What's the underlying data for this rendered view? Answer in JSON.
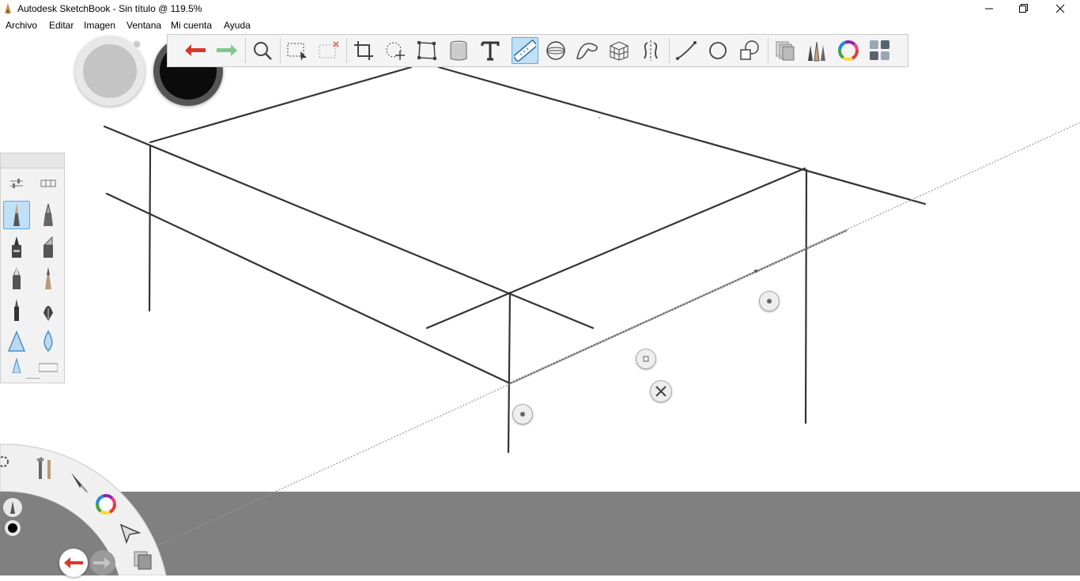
{
  "window": {
    "title": "Autodesk SketchBook - Sin título @ 119.5%",
    "controls": [
      "minimize-icon",
      "maximize-icon",
      "close-icon"
    ]
  },
  "menubar": {
    "items": [
      "Archivo",
      "Editar",
      "Imagen",
      "Ventana",
      "Mi cuenta",
      "Ayuda"
    ]
  },
  "toolbar": {
    "tools": [
      "undo-icon",
      "redo-icon",
      "zoom-icon",
      "rectangle-select-icon",
      "clear-selection-icon",
      "crop-icon",
      "transform-icon",
      "distort-icon",
      "fill-bucket-icon",
      "text-icon",
      "ruler-icon",
      "ellipse-guide-icon",
      "french-curve-icon",
      "perspective-icon",
      "symmetry-icon",
      "line-icon",
      "circle-icon",
      "shape-icon",
      "layers-icon",
      "brushes-icon",
      "color-wheel-icon",
      "copic-library-icon"
    ],
    "active_tool": "ruler-icon"
  },
  "colors": {
    "canvas": "#ffffff",
    "bottom_bar": "#808080",
    "active_highlight": "#bfe0f7",
    "undo_red": "#d9372a",
    "redo_green": "#7fc98b"
  },
  "brush_palette": {
    "brushes": [
      "pencil-brush",
      "ink-pen-brush",
      "marker-brush",
      "chisel-marker-brush",
      "ballpoint-brush",
      "airbrush-brush",
      "felt-pen-brush",
      "fountain-pen-brush",
      "triangle-brush",
      "drop-brush",
      "taper-brush",
      "eraser-brush"
    ],
    "active_brush": "pencil-brush"
  },
  "lagoon": {
    "items": [
      "settings-icon",
      "tools-icon",
      "paint-brush-icon",
      "color-wheel-icon",
      "select-arrow-icon",
      "layers-icon",
      "undo-icon",
      "redo-icon"
    ]
  }
}
